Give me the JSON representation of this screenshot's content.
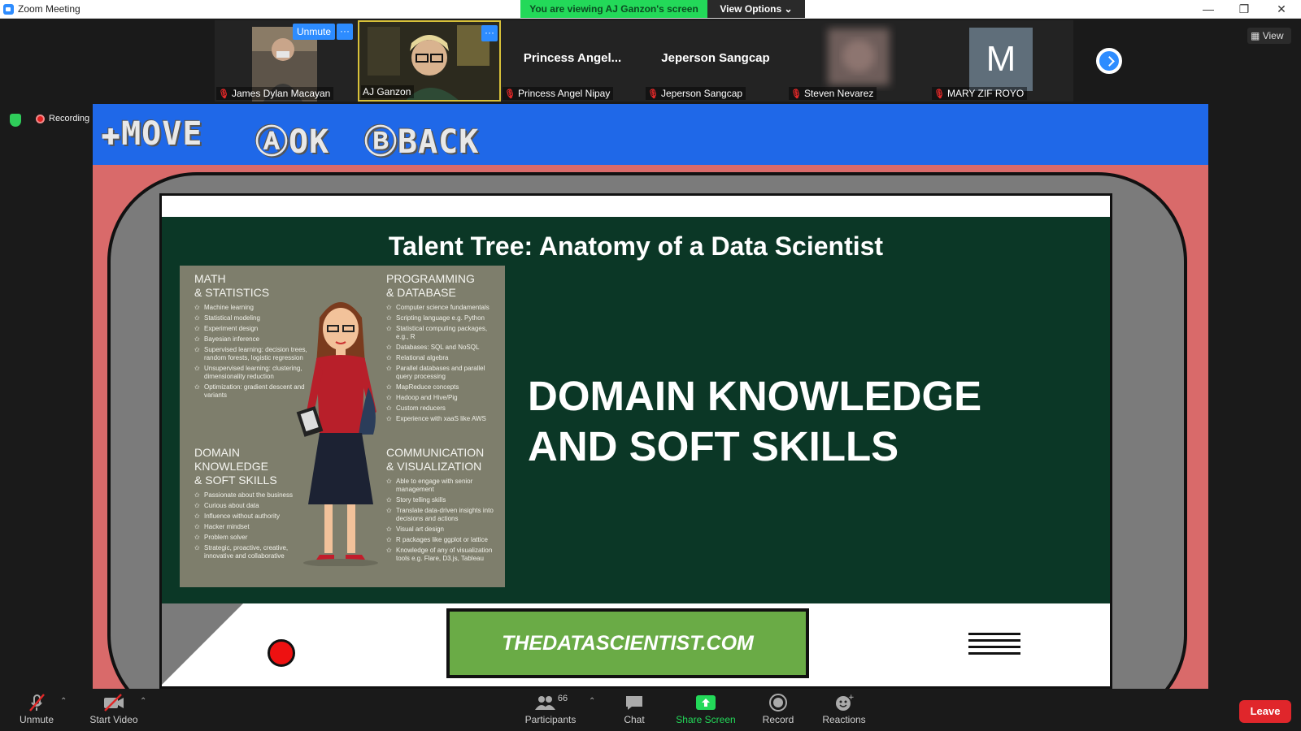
{
  "window": {
    "title": "Zoom Meeting",
    "viewing_banner": "You are viewing AJ Ganzon's screen",
    "view_options": "View Options",
    "minimize": "—",
    "restore": "❐",
    "close": "✕"
  },
  "participants_strip": {
    "tiles": [
      {
        "name": "James Dylan Macayan",
        "unmute_label": "Unmute",
        "more_label": "···"
      },
      {
        "name": "AJ Ganzon",
        "more_label": "···"
      },
      {
        "display_name": "Princess  Angel...",
        "name": "Princess Angel Nipay"
      },
      {
        "display_name": "Jeperson Sangcap",
        "name": "Jeperson Sangcap"
      },
      {
        "name": "Steven Nevarez"
      },
      {
        "avatar_letter": "M",
        "name": "MARY ZIF ROYO"
      }
    ],
    "view_label": "View"
  },
  "status": {
    "recording": "Recording"
  },
  "shared_screen": {
    "controls_bar": {
      "move": "✚MOVE",
      "ok": "ⒶOK",
      "back": "ⒷBACK"
    },
    "slide": {
      "title": "Talent Tree: Anatomy of a Data Scientist",
      "heading_line1": "DOMAIN KNOWLEDGE",
      "heading_line2": "AND SOFT SKILLS",
      "infographic": {
        "math": {
          "title": "MATH\n& STATISTICS",
          "items": [
            "Machine learning",
            "Statistical modeling",
            "Experiment design",
            "Bayesian inference",
            "Supervised learning: decision trees, random forests, logistic regression",
            "Unsupervised learning: clustering, dimensionality reduction",
            "Optimization: gradient descent and variants"
          ]
        },
        "programming": {
          "title": "PROGRAMMING\n& DATABASE",
          "items": [
            "Computer science fundamentals",
            "Scripting language e.g. Python",
            "Statistical computing packages, e.g., R",
            "Databases: SQL and NoSQL",
            "Relational algebra",
            "Parallel databases and parallel query processing",
            "MapReduce concepts",
            "Hadoop and Hive/Pig",
            "Custom reducers",
            "Experience with xaaS like AWS"
          ]
        },
        "domain": {
          "title": "DOMAIN KNOWLEDGE\n& SOFT SKILLS",
          "items": [
            "Passionate about the business",
            "Curious about data",
            "Influence without authority",
            "Hacker mindset",
            "Problem solver",
            "Strategic, proactive, creative, innovative and collaborative"
          ]
        },
        "communication": {
          "title": "COMMUNICATION\n& VISUALIZATION",
          "items": [
            "Able to engage with senior management",
            "Story telling skills",
            "Translate data-driven insights into decisions and actions",
            "Visual art design",
            "R packages like ggplot or lattice",
            "Knowledge of any of visualization tools e.g. Flare, D3.js, Tableau"
          ]
        }
      },
      "website": "THEDATASCIENTIST.COM"
    }
  },
  "toolbar": {
    "unmute": "Unmute",
    "start_video": "Start Video",
    "participants_count": "66",
    "participants": "Participants",
    "chat": "Chat",
    "share_screen": "Share Screen",
    "record": "Record",
    "reactions": "Reactions",
    "leave": "Leave"
  },
  "colors": {
    "zoom_blue": "#2d8cff",
    "banner_green": "#23d959",
    "slide_green": "#0b3726",
    "leave_red": "#e0262b",
    "share_screen_green": "#23d959"
  }
}
